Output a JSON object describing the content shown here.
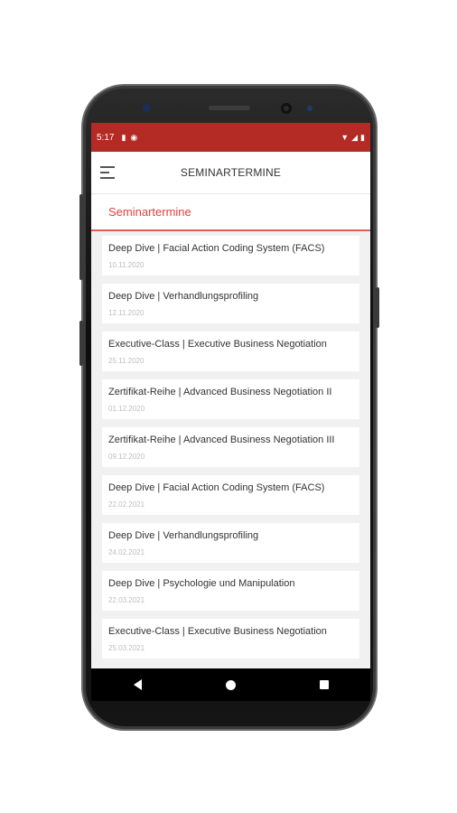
{
  "status_bar": {
    "time": "5:17",
    "icons_left": [
      "sim-card-icon",
      "cast-icon"
    ],
    "icons_right": [
      "wifi-icon",
      "signal-icon",
      "battery-icon"
    ]
  },
  "app_bar": {
    "title": "SEMINARTERMINE",
    "menu_icon": "hamburger-menu-icon"
  },
  "section": {
    "title": "Seminartermine"
  },
  "events": [
    {
      "title": "Deep Dive | Facial Action Coding System (FACS)",
      "date": "10.11.2020"
    },
    {
      "title": "Deep Dive | Verhandlungsprofiling",
      "date": "12.11.2020"
    },
    {
      "title": "Executive-Class | Executive Business Negotiation",
      "date": "25.11.2020"
    },
    {
      "title": "Zertifikat-Reihe | Advanced Business Negotiation II",
      "date": "01.12.2020"
    },
    {
      "title": "Zertifikat-Reihe | Advanced Business Negotiation III",
      "date": "09.12.2020"
    },
    {
      "title": "Deep Dive | Facial Action Coding System (FACS)",
      "date": "22.02.2021"
    },
    {
      "title": "Deep Dive | Verhandlungsprofiling",
      "date": "24.02.2021"
    },
    {
      "title": "Deep Dive | Psychologie und Manipulation",
      "date": "22.03.2021"
    },
    {
      "title": "Executive-Class | Executive Business Negotiation",
      "date": "25.03.2021"
    }
  ],
  "colors": {
    "status_bar": "#b42a25",
    "accent": "#e14040"
  }
}
